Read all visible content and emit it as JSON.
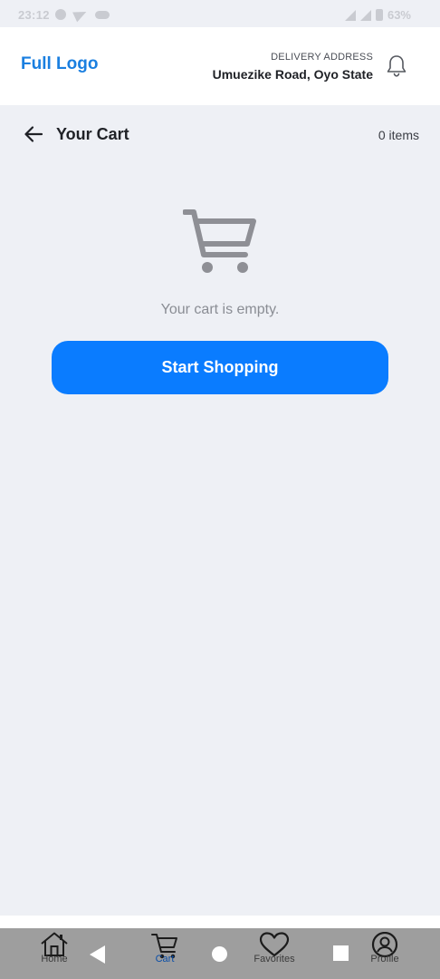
{
  "status_bar": {
    "time": "23:12",
    "battery": "63%"
  },
  "header": {
    "logo": "Full Logo",
    "delivery_label": "DELIVERY ADDRESS",
    "delivery_address": "Umuezike Road, Oyo State",
    "icons": {
      "notifications": "bell-icon"
    }
  },
  "cart_page": {
    "title": "Your Cart",
    "item_count": "0 items",
    "empty_message": "Your cart is empty.",
    "start_button": "Start Shopping",
    "icons": {
      "back": "arrow-left-icon",
      "empty_state": "shopping-cart-icon"
    }
  },
  "bottom_nav": {
    "active": "Cart",
    "items": [
      {
        "label": "Home",
        "icon": "home-icon"
      },
      {
        "label": "Cart",
        "icon": "cart-icon"
      },
      {
        "label": "Favorites",
        "icon": "heart-icon"
      },
      {
        "label": "Profile",
        "icon": "user-circle-icon"
      }
    ]
  },
  "colors": {
    "brand": "#1a7fe0",
    "primary_button": "#0a7cff",
    "background": "#eef0f5",
    "active_nav": "#0b4fa8"
  }
}
